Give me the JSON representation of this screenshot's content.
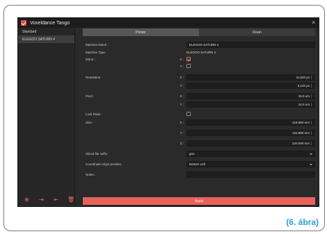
{
  "window": {
    "title": "Voxeldance Tango",
    "close": "×"
  },
  "sidebar": {
    "items": [
      "Standard",
      "ELEGOO SATURN 4"
    ],
    "icons": [
      "add-icon",
      "import-icon",
      "export-icon",
      "delete-icon"
    ]
  },
  "tabs": [
    "Printer",
    "Resin"
  ],
  "form": {
    "machine_name_label": "Machine Name :",
    "machine_name_value": "ELEGOO SATURN 4",
    "machine_type_label": "Machine Type :",
    "machine_type_value": "ELEGOO SATURN 4",
    "mirror_label": "Mirror :",
    "mirror_x": "X :",
    "mirror_y": "Y :",
    "mirror_x_checked": true,
    "mirror_y_checked": false,
    "resolution_label": "Resolution :",
    "resolution_x_axis": "X :",
    "resolution_x": "11,520 px",
    "resolution_y_axis": "Y :",
    "resolution_y": "5,120 px",
    "pixel_label": "Pixel :",
    "pixel_x_axis": "X :",
    "pixel_x": "19.0 um",
    "pixel_y_axis": "Y :",
    "pixel_y": "24.0 um",
    "lock_ratio_label": "Lock Ratio :",
    "lock_ratio_checked": false,
    "size_label": "Size :",
    "size_x_axis": "X :",
    "size_x": "218.880 mm",
    "size_y_axis": "Y :",
    "size_y": "122.880 mm",
    "size_z_axis": "Z :",
    "size_z": "220.000 mm",
    "slice_suffix_label": "Sliced file suffix :",
    "slice_suffix_value": "goo",
    "coord_origin_label": "Coordinate origin position :",
    "coord_origin_value": "Bottom Left",
    "notes_label": "Notes :",
    "notes_value": ""
  },
  "apply_label": "Apply",
  "caption": "(6. ábra)",
  "colors": {
    "accent": "#e8625c",
    "caption": "#2a9fd8"
  }
}
